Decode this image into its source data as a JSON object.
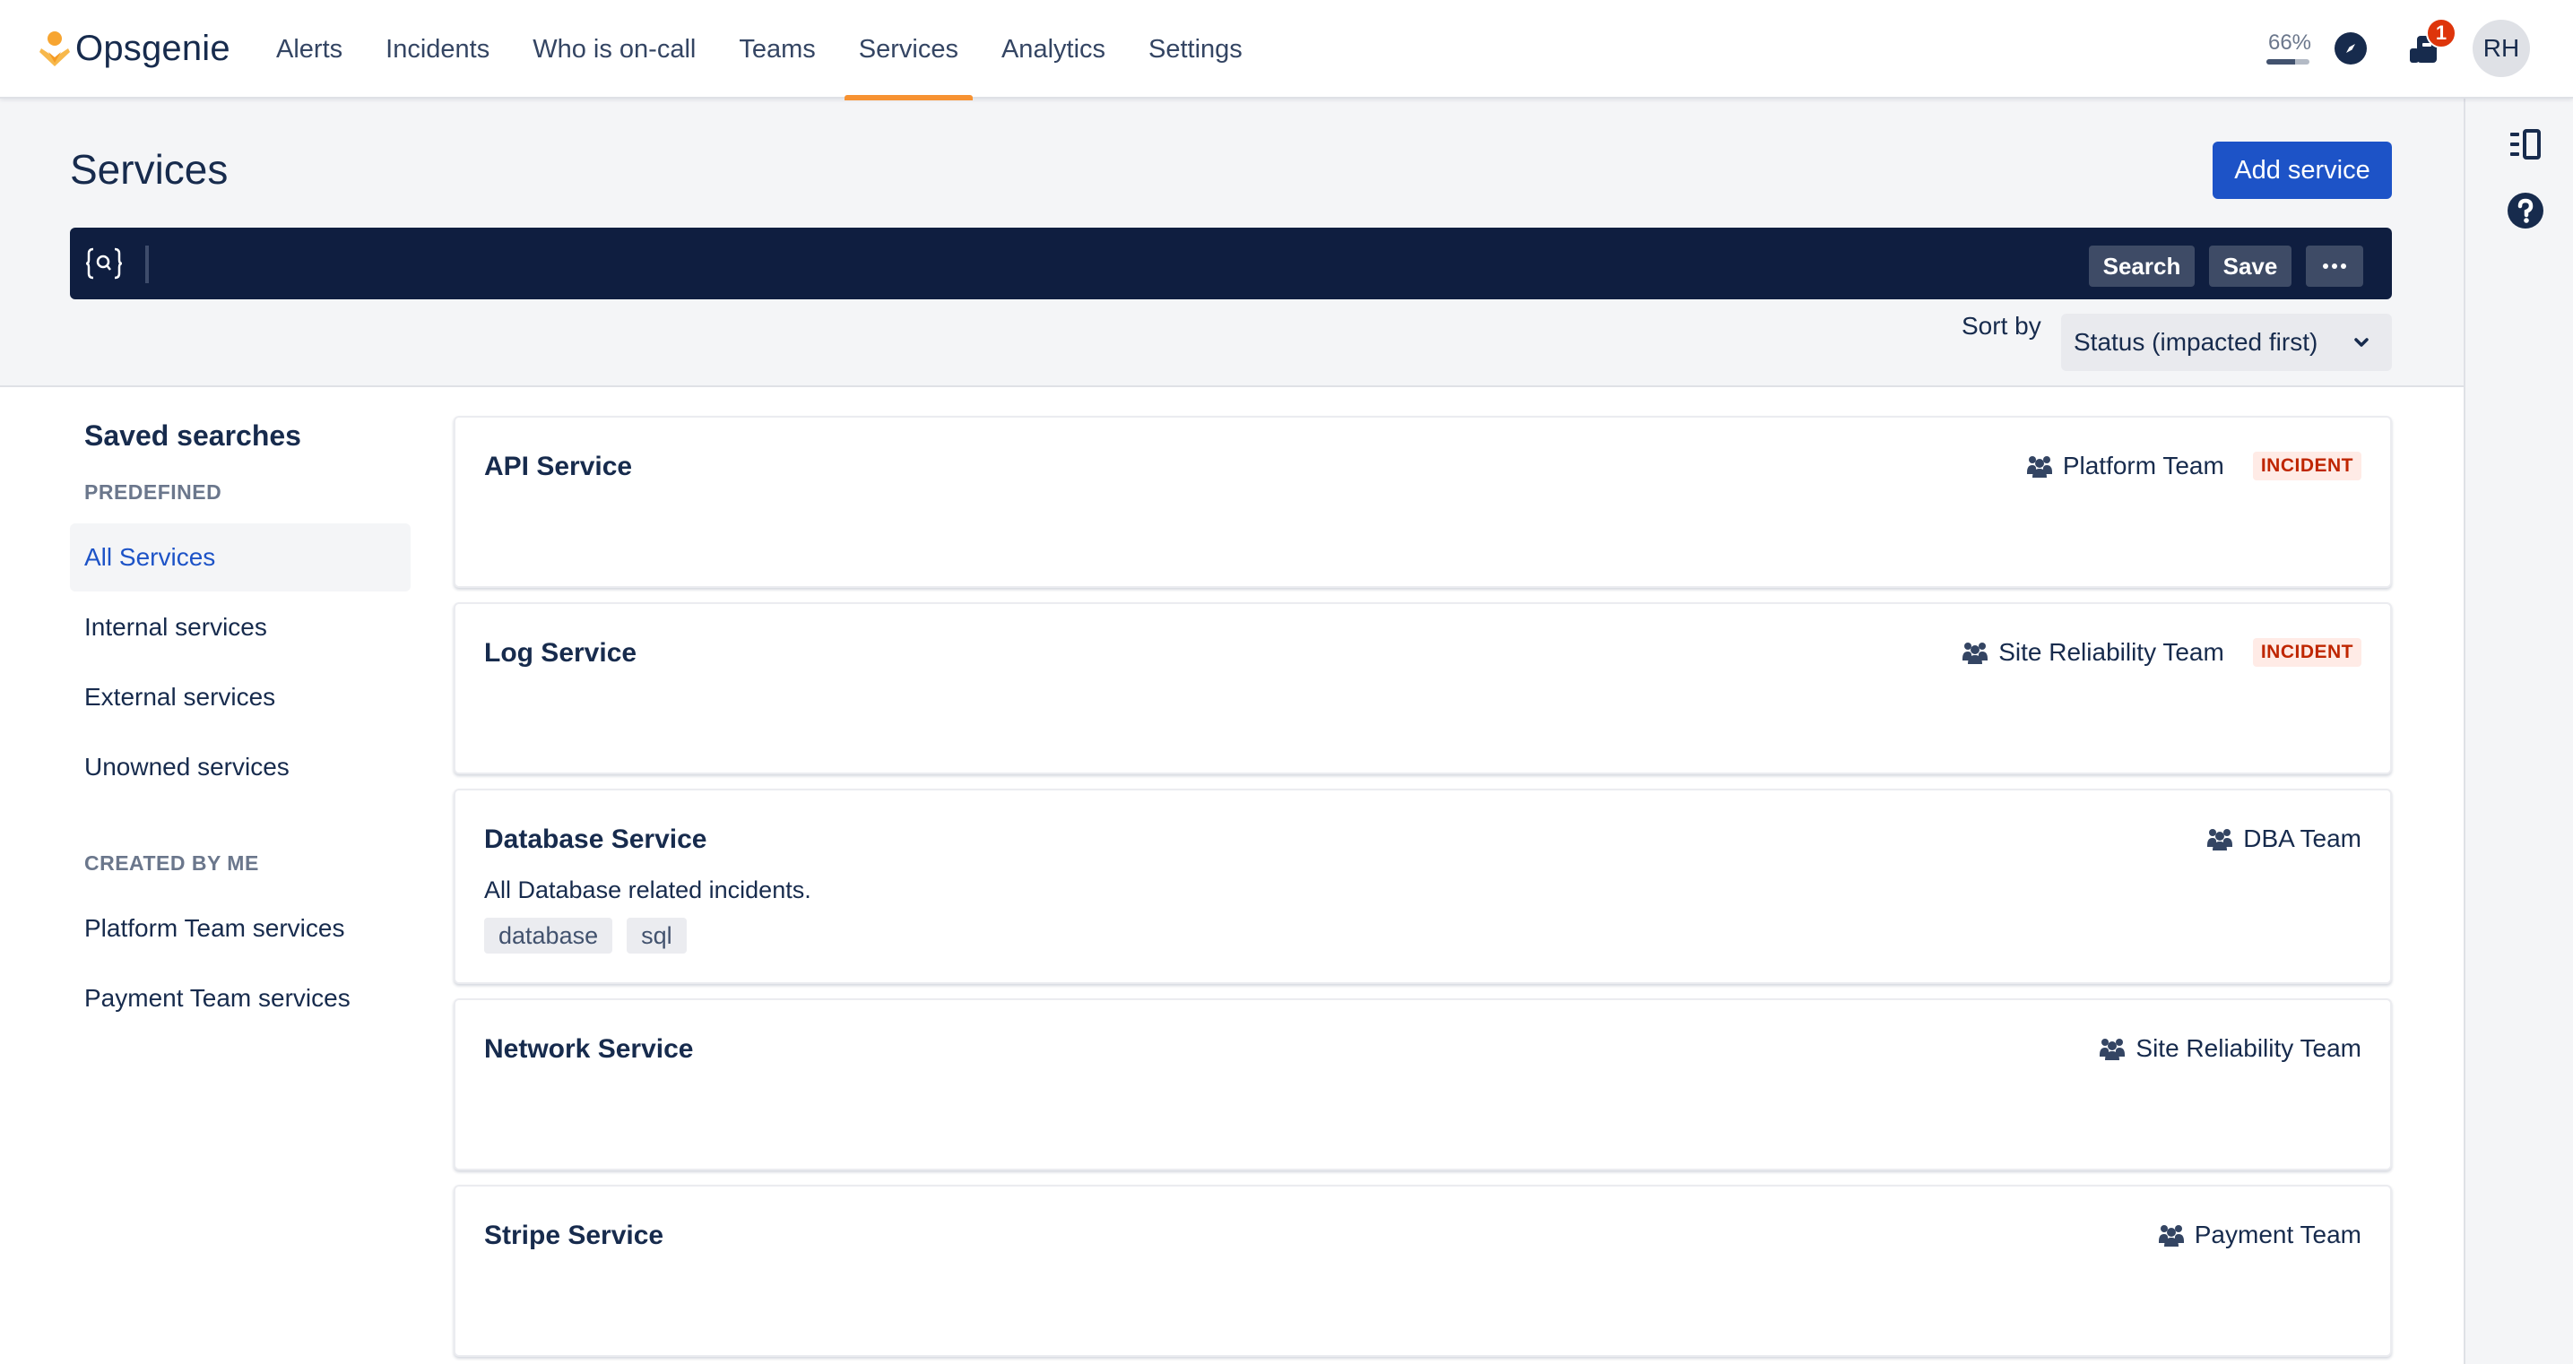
{
  "app": {
    "name": "Opsgenie",
    "brand_color": "#f79232",
    "accent_color": "#1d53c7"
  },
  "nav": {
    "items": [
      {
        "label": "Alerts",
        "active": false
      },
      {
        "label": "Incidents",
        "active": false
      },
      {
        "label": "Who is on-call",
        "active": false
      },
      {
        "label": "Teams",
        "active": false
      },
      {
        "label": "Services",
        "active": true
      },
      {
        "label": "Analytics",
        "active": false
      },
      {
        "label": "Settings",
        "active": false
      }
    ],
    "quota_label": "66%",
    "quota_percent": 66,
    "notification_count": "1",
    "avatar_initials": "RH",
    "compass_icon": "compass-icon",
    "notification_icon": "megaphone-icon"
  },
  "page": {
    "title": "Services",
    "add_button": "Add service"
  },
  "search": {
    "icon": "query-search-icon",
    "value": "",
    "placeholder": "",
    "search_button": "Search",
    "save_button": "Save",
    "more_button": "···"
  },
  "sort": {
    "label": "Sort by",
    "selected": "Status (impacted first)"
  },
  "saved_searches": {
    "title": "Saved searches",
    "sections": [
      {
        "heading": "PREDEFINED",
        "items": [
          {
            "label": "All Services",
            "active": true
          },
          {
            "label": "Internal services",
            "active": false
          },
          {
            "label": "External services",
            "active": false
          },
          {
            "label": "Unowned services",
            "active": false
          }
        ]
      },
      {
        "heading": "CREATED BY ME",
        "items": [
          {
            "label": "Platform Team services",
            "active": false
          },
          {
            "label": "Payment Team services",
            "active": false
          }
        ]
      }
    ]
  },
  "services": [
    {
      "name": "API Service",
      "team": "Platform Team",
      "status": "INCIDENT",
      "description": "",
      "tags": []
    },
    {
      "name": "Log Service",
      "team": "Site Reliability Team",
      "status": "INCIDENT",
      "description": "",
      "tags": []
    },
    {
      "name": "Database Service",
      "team": "DBA Team",
      "status": "",
      "description": "All Database related incidents.",
      "tags": [
        "database",
        "sql"
      ]
    },
    {
      "name": "Network Service",
      "team": "Site Reliability Team",
      "status": "",
      "description": "",
      "tags": []
    },
    {
      "name": "Stripe Service",
      "team": "Payment Team",
      "status": "",
      "description": "",
      "tags": []
    }
  ],
  "right_rail": {
    "icons": [
      "panel-toggle-icon",
      "help-icon"
    ]
  }
}
